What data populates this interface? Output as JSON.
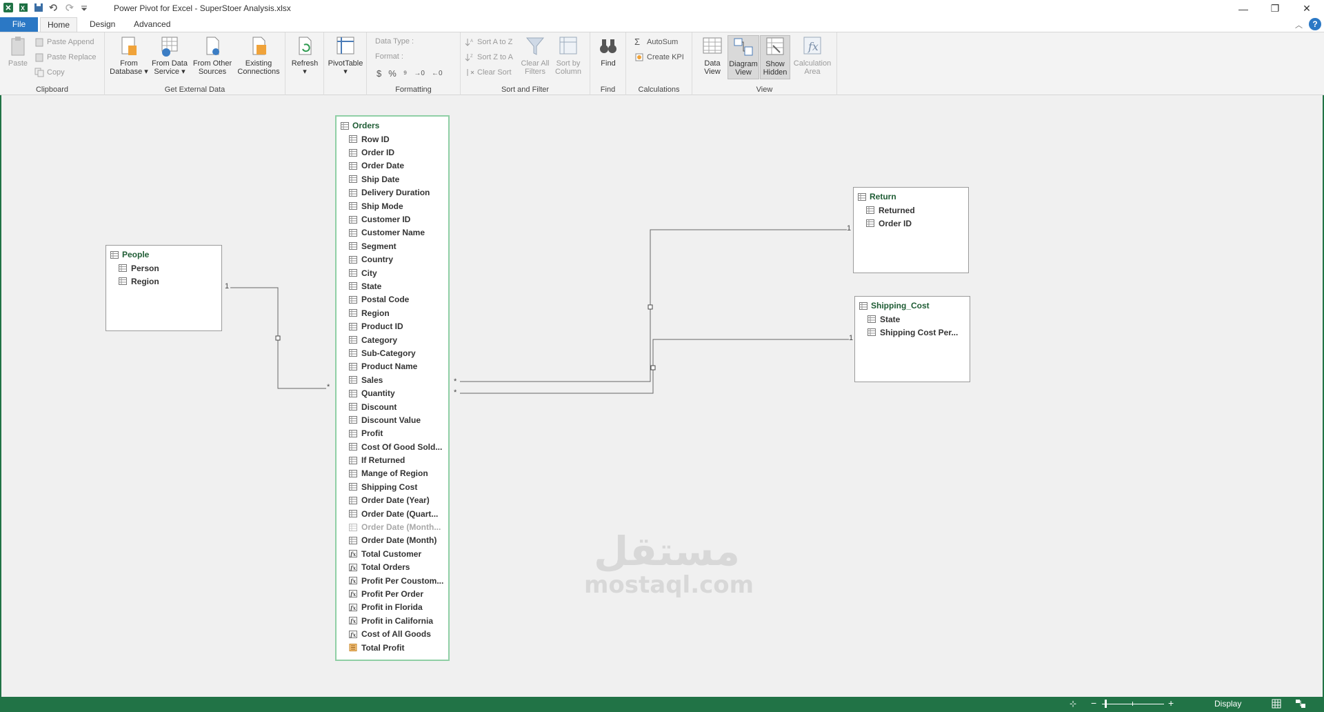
{
  "window": {
    "title": "Power Pivot for Excel - SuperStoer Analysis.xlsx",
    "minimize": "—",
    "restore": "❐",
    "close": "✕"
  },
  "tabs": [
    {
      "label": "File"
    },
    {
      "label": "Home"
    },
    {
      "label": "Design"
    },
    {
      "label": "Advanced"
    }
  ],
  "ribbon": {
    "clipboard": {
      "label": "Clipboard",
      "paste": "Paste",
      "paste_append": "Paste Append",
      "paste_replace": "Paste Replace",
      "copy": "Copy"
    },
    "external": {
      "label": "Get External Data",
      "from_database": [
        "From",
        "Database"
      ],
      "from_data_service": [
        "From Data",
        "Service"
      ],
      "from_other_sources": [
        "From Other",
        "Sources"
      ],
      "existing_connections": [
        "Existing",
        "Connections"
      ]
    },
    "refresh": "Refresh",
    "pivottable": "PivotTable",
    "formatting": {
      "label": "Formatting",
      "data_type": "Data Type :",
      "format": "Format :",
      "currency": "$",
      "percent": "%",
      "comma": "⁹"
    },
    "sort_filter": {
      "label": "Sort and Filter",
      "sort_az": "Sort A to Z",
      "sort_za": "Sort Z to A",
      "clear_sort": "Clear Sort",
      "clear_all_filters": [
        "Clear All",
        "Filters"
      ],
      "sort_by_column": [
        "Sort by",
        "Column"
      ]
    },
    "find": {
      "label": "Find",
      "button": "Find"
    },
    "calculations": {
      "label": "Calculations",
      "autosum": "AutoSum",
      "create_kpi": "Create KPI"
    },
    "view": {
      "label": "View",
      "data_view": [
        "Data",
        "View"
      ],
      "diagram_view": [
        "Diagram",
        "View"
      ],
      "show_hidden": [
        "Show",
        "Hidden"
      ],
      "calculation_area": [
        "Calculation",
        "Area"
      ]
    }
  },
  "diagram": {
    "tables": {
      "people": {
        "name": "People",
        "columns": [
          "Person",
          "Region"
        ]
      },
      "orders": {
        "name": "Orders",
        "columns": [
          {
            "name": "Row ID",
            "type": "column"
          },
          {
            "name": "Order ID",
            "type": "column"
          },
          {
            "name": "Order Date",
            "type": "column"
          },
          {
            "name": "Ship Date",
            "type": "column"
          },
          {
            "name": "Delivery Duration",
            "type": "column"
          },
          {
            "name": "Ship Mode",
            "type": "column"
          },
          {
            "name": "Customer ID",
            "type": "column"
          },
          {
            "name": "Customer Name",
            "type": "column"
          },
          {
            "name": "Segment",
            "type": "column"
          },
          {
            "name": "Country",
            "type": "column"
          },
          {
            "name": "City",
            "type": "column"
          },
          {
            "name": "State",
            "type": "column"
          },
          {
            "name": "Postal Code",
            "type": "column"
          },
          {
            "name": "Region",
            "type": "column"
          },
          {
            "name": "Product ID",
            "type": "column"
          },
          {
            "name": "Category",
            "type": "column"
          },
          {
            "name": "Sub-Category",
            "type": "column"
          },
          {
            "name": "Product Name",
            "type": "column"
          },
          {
            "name": "Sales",
            "type": "column"
          },
          {
            "name": "Quantity",
            "type": "column"
          },
          {
            "name": "Discount",
            "type": "column"
          },
          {
            "name": "Discount Value",
            "type": "column"
          },
          {
            "name": "Profit",
            "type": "column"
          },
          {
            "name": "Cost Of Good Sold...",
            "type": "column"
          },
          {
            "name": "If Returned",
            "type": "column"
          },
          {
            "name": "Mange of Region",
            "type": "column"
          },
          {
            "name": "Shipping Cost",
            "type": "column"
          },
          {
            "name": "Order Date (Year)",
            "type": "column"
          },
          {
            "name": "Order Date (Quart...",
            "type": "column"
          },
          {
            "name": "Order Date (Month...",
            "type": "hidden"
          },
          {
            "name": "Order Date (Month)",
            "type": "column"
          },
          {
            "name": "Total Customer",
            "type": "measure"
          },
          {
            "name": "Total Orders",
            "type": "measure"
          },
          {
            "name": "Profit Per Coustom...",
            "type": "measure"
          },
          {
            "name": "Profit Per Order",
            "type": "measure"
          },
          {
            "name": "Profit in Florida",
            "type": "measure"
          },
          {
            "name": "Profit in California",
            "type": "measure"
          },
          {
            "name": "Cost of All Goods",
            "type": "measure"
          },
          {
            "name": "Total Profit",
            "type": "kpi"
          }
        ]
      },
      "return": {
        "name": "Return",
        "columns": [
          "Returned",
          "Order ID"
        ]
      },
      "shipping_cost": {
        "name": "Shipping_Cost",
        "columns": [
          "State",
          "Shipping Cost Per..."
        ]
      }
    },
    "cardinality": {
      "one": "1",
      "many": "*"
    }
  },
  "watermark": {
    "arabic": "مستقل",
    "latin": "mostaql.com"
  },
  "statusbar": {
    "display": "Display"
  },
  "colors": {
    "accent_green": "#217346",
    "file_tab_blue": "#2b78c5",
    "table_title_green": "#1e5c34"
  }
}
